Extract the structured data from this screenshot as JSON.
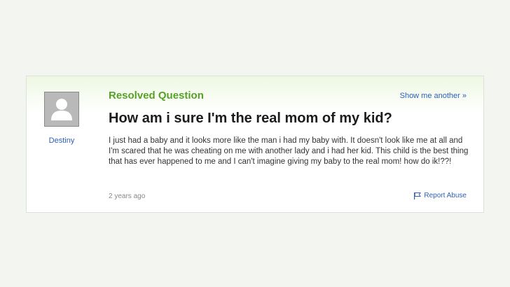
{
  "question": {
    "status_label": "Resolved Question",
    "show_another_label": "Show me another »",
    "title": "How am i sure I'm the real mom of my kid?",
    "body": "I just had a baby and it looks more like the man i had my baby with. It doesn't look like me at all and I'm scared that he was cheating on me with another lady and i had her kid. This child is the best thing that has ever happened to me and I can't imagine giving my baby to the real mom! how do ik!??!",
    "timestamp": "2 years ago",
    "report_label": "Report Abuse"
  },
  "asker": {
    "name": "Destiny",
    "avatar_icon": "default-user-silhouette-icon"
  },
  "report_icon": "flag-icon",
  "colors": {
    "resolved_green": "#56a225",
    "link_blue": "#2d5fb5",
    "title_text": "#1c1c1c",
    "body_text": "#333333"
  }
}
